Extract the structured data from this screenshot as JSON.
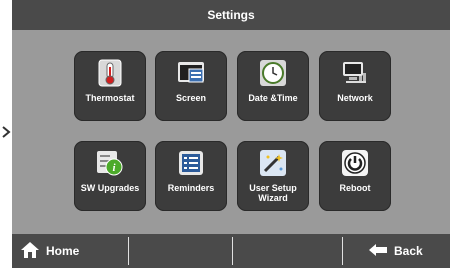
{
  "header": {
    "title": "Settings"
  },
  "tiles": [
    {
      "label": "Thermostat",
      "icon": "thermometer-icon"
    },
    {
      "label": "Screen",
      "icon": "screen-icon"
    },
    {
      "label": "Date &Time",
      "icon": "clock-icon"
    },
    {
      "label": "Network",
      "icon": "network-icon"
    },
    {
      "label": "SW Upgrades",
      "icon": "info-icon"
    },
    {
      "label": "Reminders",
      "icon": "list-icon"
    },
    {
      "label": "User Setup Wizard",
      "icon": "wizard-icon"
    },
    {
      "label": "Reboot",
      "icon": "power-icon"
    }
  ],
  "footer": {
    "home_label": "Home",
    "back_label": "Back"
  }
}
